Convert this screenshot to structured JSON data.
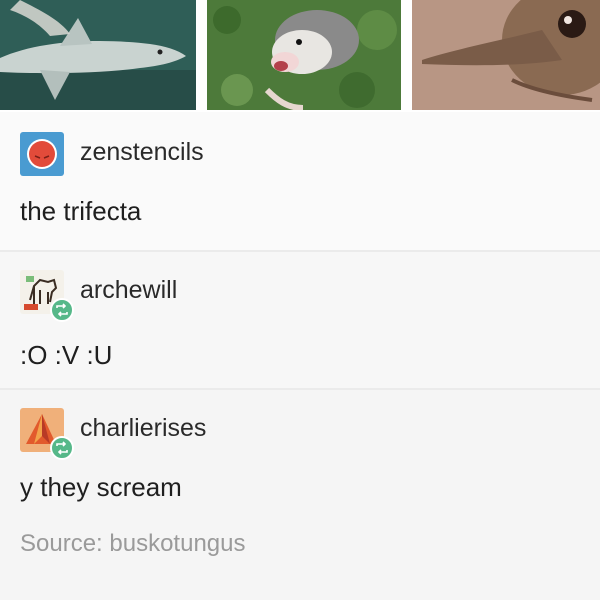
{
  "posts": [
    {
      "username": "zenstencils",
      "text": "the trifecta",
      "avatar_icon": "red-circle-face-icon",
      "accent": "#4a9bd1"
    },
    {
      "username": "archewill",
      "text": ":O :V :U",
      "avatar_icon": "horse-drawing-icon",
      "reblog_icon": "reblog-icon"
    },
    {
      "username": "charlierises",
      "text": "y they scream",
      "avatar_icon": "orange-triangle-icon",
      "reblog_icon": "reblog-icon"
    }
  ],
  "source": {
    "text": "Source: buskotungus"
  },
  "colors": {
    "reblog_badge": "#56b889",
    "source_text": "#9a9a9a"
  },
  "images": [
    "shark-photo",
    "opossum-photo",
    "elephant-shrew-photo"
  ]
}
